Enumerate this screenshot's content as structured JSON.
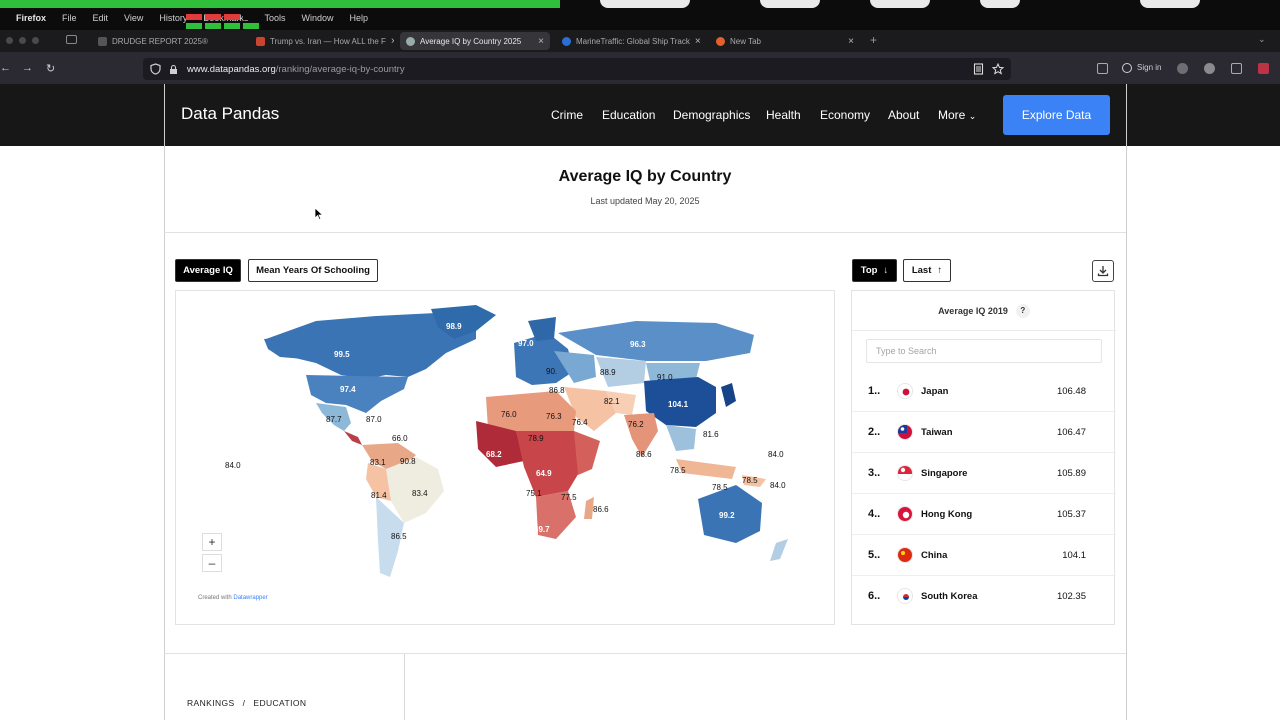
{
  "mac_menu": [
    "Firefox",
    "File",
    "Edit",
    "View",
    "History",
    "Bookmarks",
    "Tools",
    "Window",
    "Help"
  ],
  "tabs": [
    {
      "label": "DRUDGE REPORT 2025®",
      "active": false
    },
    {
      "label": "Trump vs. Iran — How ALL the F",
      "active": false
    },
    {
      "label": "Average IQ by Country 2025",
      "active": true
    },
    {
      "label": "MarineTraffic: Global Ship Track",
      "active": false
    },
    {
      "label": "New Tab",
      "active": false
    }
  ],
  "url": {
    "domain": "www.datapandas.org",
    "path": "/ranking/average-iq-by-country"
  },
  "toolbar": {
    "signin": "Sign in"
  },
  "site": {
    "logo": "Data Pandas",
    "nav": [
      "Crime",
      "Education",
      "Demographics",
      "Health",
      "Economy",
      "About",
      "More"
    ],
    "cta": "Explore Data",
    "brand_color": "#3b82f6"
  },
  "page": {
    "title": "Average IQ by Country",
    "updated": "Last updated May 20, 2025"
  },
  "map_toggles": {
    "avg": "Average IQ",
    "school": "Mean Years Of Schooling"
  },
  "map": {
    "zoom_in": "+",
    "zoom_out": "–",
    "credit_prefix": "Created with",
    "credit_link": "Datawrapper",
    "labels": [
      "98.9",
      "99.5",
      "97.4",
      "87.7",
      "87.0",
      "66.0",
      "84.0",
      "83.1",
      "90.8",
      "81.4",
      "83.4",
      "86.5",
      "97.0",
      "96.3",
      "90.",
      "88.9",
      "91.0",
      "86.8",
      "104.1",
      "76.0",
      "76.3",
      "82.1",
      "76.2",
      "81.6",
      "78.9",
      "76.4",
      "68.2",
      "84.0",
      "64.9",
      "88.6",
      "78.5",
      "78.5",
      "84.0",
      "75.1",
      "77.5",
      "86.6",
      "78.5",
      "69.7",
      "99.2"
    ]
  },
  "ranking": {
    "sort_top": "Top",
    "sort_last": "Last",
    "header": "Average IQ 2019",
    "help": "?",
    "search_placeholder": "Type to Search",
    "rows": [
      {
        "rank": "1..",
        "name": "Japan",
        "value": "106.48"
      },
      {
        "rank": "2..",
        "name": "Taiwan",
        "value": "106.47"
      },
      {
        "rank": "3..",
        "name": "Singapore",
        "value": "105.89"
      },
      {
        "rank": "4..",
        "name": "Hong Kong",
        "value": "105.37"
      },
      {
        "rank": "5..",
        "name": "China",
        "value": "104.1"
      },
      {
        "rank": "6..",
        "name": "South Korea",
        "value": "102.35"
      }
    ]
  },
  "breadcrumbs": [
    "RANKINGS",
    "/",
    "EDUCATION"
  ]
}
